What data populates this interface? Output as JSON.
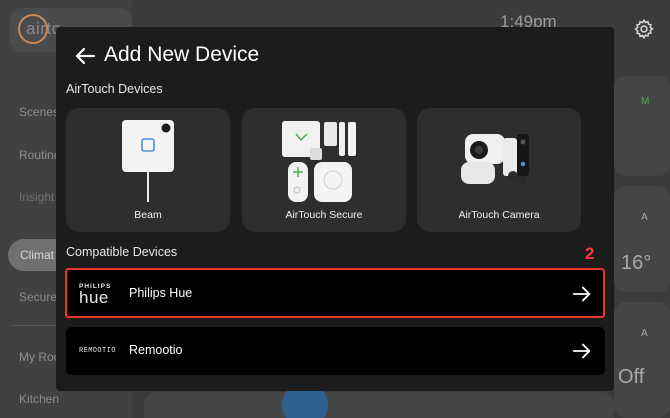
{
  "background": {
    "logo_text": "airto",
    "time": "1:49pm",
    "nav": [
      "Scenes",
      "Routine",
      "Insight",
      "Climat",
      "Secure",
      "My Roo",
      "Kitchen"
    ],
    "right_labels": [
      "M",
      "A",
      "16°",
      "A",
      "Off"
    ]
  },
  "modal": {
    "title": "Add New Device",
    "airtouch_section_label": "AirTouch Devices",
    "devices": [
      {
        "label": "Beam"
      },
      {
        "label": "AirTouch Secure"
      },
      {
        "label": "AirTouch Camera"
      }
    ],
    "compatible_section_label": "Compatible Devices",
    "compatible": [
      {
        "logo_top": "PHILIPS",
        "logo_bottom": "hue",
        "label": "Philips Hue"
      },
      {
        "logo_text": "REMOOTIO",
        "label": "Remootio"
      }
    ]
  },
  "annotation": {
    "badge": "2",
    "highlight_color": "#e8342a"
  },
  "colors": {
    "modal_bg": "#1c1c1d",
    "card_bg": "#2e2e30",
    "row_bg": "#000000",
    "accent_red": "#ff3b30"
  }
}
